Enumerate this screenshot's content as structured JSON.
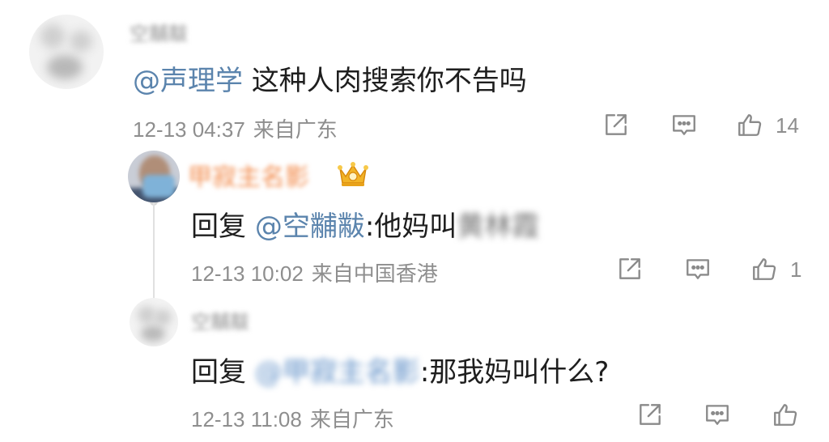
{
  "main_comment": {
    "username": "空黼黻",
    "text_mention": "@声理学",
    "text_body": " 这种人肉搜索你不告吗",
    "time": "12-13 04:37",
    "location": "来自广东",
    "likes": "14"
  },
  "replies": [
    {
      "username": "甲寂主名影",
      "reply_prefix": "回复 ",
      "mention": "@空黼黻",
      "text_before": ":他妈叫",
      "blurred_name": "黄林霞",
      "time": "12-13 10:02",
      "location": "来自中国香港",
      "likes": "1"
    },
    {
      "username": "空黼黻",
      "reply_prefix": "回复 ",
      "mention": "@甲寂主名影",
      "text_after": ":那我妈叫什么?",
      "time": "12-13 11:08",
      "location": "来自广东"
    }
  ],
  "icons": {
    "share": "share-icon",
    "comment": "comment-icon",
    "like": "thumbs-up-icon",
    "vip": "crown-vip-icon"
  },
  "colors": {
    "mention": "#5b84ad",
    "meta": "#8e8e8e",
    "vip_gold": "#e8a21a"
  }
}
